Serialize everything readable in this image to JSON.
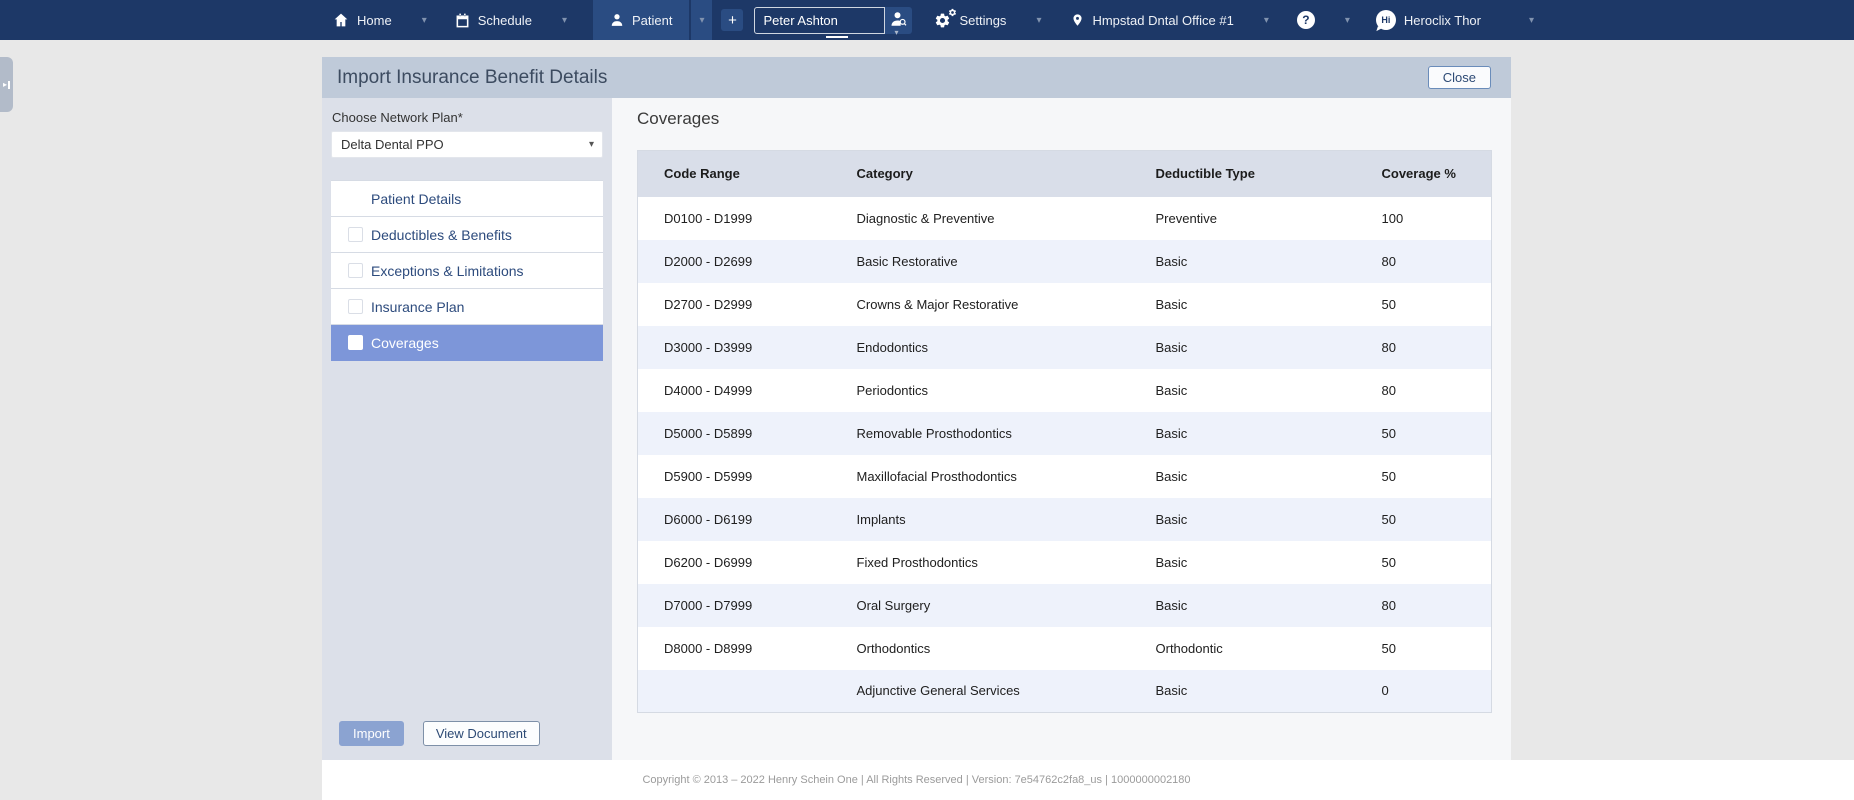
{
  "nav": {
    "home_label": "Home",
    "schedule_label": "Schedule",
    "patient_label": "Patient",
    "patient_search_value": "Peter Ashton",
    "settings_label": "Settings",
    "location_label": "Hmpstad Dntal Office #1",
    "user_name": "Heroclix Thor"
  },
  "icons": {
    "plus": "+",
    "help": "?",
    "user_logo": "Hi",
    "caret": "▾",
    "select_caret": "▾",
    "side_tab_arrow": "▸"
  },
  "panel": {
    "title": "Import Insurance Benefit Details",
    "close_button_label": "Close",
    "sidebar": {
      "network_plan_label": "Choose Network Plan*",
      "network_plan_value": "Delta Dental PPO",
      "sections": [
        {
          "label": "Patient Details",
          "checkbox": false,
          "selected": false
        },
        {
          "label": "Deductibles & Benefits",
          "checkbox": true,
          "selected": false
        },
        {
          "label": "Exceptions & Limitations",
          "checkbox": true,
          "selected": false
        },
        {
          "label": "Insurance Plan",
          "checkbox": true,
          "selected": false
        },
        {
          "label": "Coverages",
          "checkbox": true,
          "selected": true
        }
      ],
      "import_button_label": "Import",
      "view_document_button_label": "View Document"
    },
    "content": {
      "heading": "Coverages",
      "table": {
        "columns": [
          "Code Range",
          "Category",
          "Deductible Type",
          "Coverage %"
        ],
        "rows": [
          [
            "D0100 - D1999",
            "Diagnostic & Preventive",
            "Preventive",
            "100"
          ],
          [
            "D2000 - D2699",
            "Basic Restorative",
            "Basic",
            "80"
          ],
          [
            "D2700 - D2999",
            "Crowns & Major Restorative",
            "Basic",
            "50"
          ],
          [
            "D3000 - D3999",
            "Endodontics",
            "Basic",
            "80"
          ],
          [
            "D4000 - D4999",
            "Periodontics",
            "Basic",
            "80"
          ],
          [
            "D5000 - D5899",
            "Removable Prosthodontics",
            "Basic",
            "50"
          ],
          [
            "D5900 - D5999",
            "Maxillofacial Prosthodontics",
            "Basic",
            "50"
          ],
          [
            "D6000 - D6199",
            "Implants",
            "Basic",
            "50"
          ],
          [
            "D6200 - D6999",
            "Fixed Prosthodontics",
            "Basic",
            "50"
          ],
          [
            "D7000 - D7999",
            "Oral Surgery",
            "Basic",
            "80"
          ],
          [
            "D8000 - D8999",
            "Orthodontics",
            "Orthodontic",
            "50"
          ],
          [
            "",
            "Adjunctive General Services",
            "Basic",
            "0"
          ]
        ]
      }
    }
  },
  "footer": {
    "text": "Copyright © 2013 – 2022 Henry Schein One | All Rights Reserved | Version: 7e54762c2fa8_us | 1000000002180"
  },
  "colors": {
    "nav_bg": "#1d3867",
    "nav_active_bg": "#2a4c82",
    "panel_header_bg": "#bfcad9",
    "sidebar_bg": "#dce0e9",
    "selected_section_bg": "#7d96d9",
    "import_button_bg": "#8ba3d1",
    "table_header_bg": "#d9dee9",
    "row_alt_bg": "#eef2fb",
    "content_bg": "#f6f7f9",
    "page_bg": "#e8e8e8"
  }
}
